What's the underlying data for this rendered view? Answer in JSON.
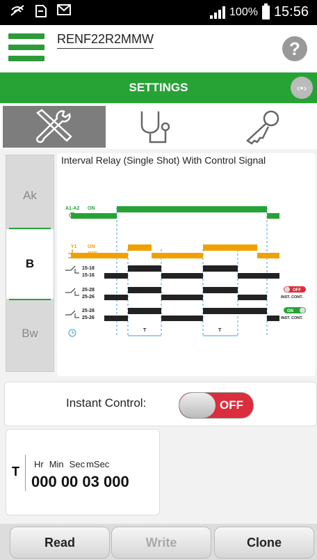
{
  "status": {
    "battery": "100%",
    "time": "15:56"
  },
  "header": {
    "device_name": "RENF22R2MMW",
    "help_glyph": "?"
  },
  "settings_bar": {
    "title": "SETTINGS",
    "nav_glyph": "‹•›"
  },
  "tools": [
    "settings-tools-icon",
    "stethoscope-icon",
    "key-icon"
  ],
  "side_tabs": [
    {
      "label": "Ak"
    },
    {
      "label": "B"
    },
    {
      "label": "Bw"
    }
  ],
  "diagram": {
    "title": "Interval Relay (Single Shot) With Control Signal",
    "labels": {
      "a1a2": "A1-A2",
      "on": "ON",
      "off": "OFF",
      "y1": "Y1",
      "c1a": "15-18",
      "c1b": "15-16",
      "c2a": "25-28",
      "c2b": "25-26",
      "c3a": "25-28",
      "c3b": "25-26",
      "t": "T",
      "inst_cont": "INST. CONT.",
      "badge_off": "OFF",
      "badge_on": "ON"
    }
  },
  "instant_control": {
    "label": "Instant Control:",
    "state": "OFF"
  },
  "timer": {
    "name": "T",
    "units": [
      "Hr",
      "Min",
      "Sec",
      "mSec"
    ],
    "value": "000 00 03 000"
  },
  "buttons": {
    "read": "Read",
    "write": "Write",
    "clone": "Clone"
  },
  "colors": {
    "green": "#27a336",
    "orange": "#f0a000",
    "red": "#dc2d3d"
  }
}
